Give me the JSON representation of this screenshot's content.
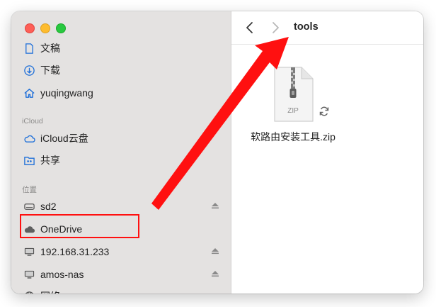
{
  "window": {
    "folder_title": "tools"
  },
  "sidebar": {
    "sections": [
      {
        "header": ""
      },
      {
        "header": "iCloud"
      },
      {
        "header": "位置"
      }
    ],
    "items": [
      {
        "label": "文稿",
        "icon": "document-icon"
      },
      {
        "label": "下载",
        "icon": "download-icon"
      },
      {
        "label": "yuqingwang",
        "icon": "home-icon"
      },
      {
        "label": "iCloud云盘",
        "icon": "icloud-icon"
      },
      {
        "label": "共享",
        "icon": "shared-folder-icon"
      },
      {
        "label": "sd2",
        "icon": "drive-icon",
        "ejectable": true
      },
      {
        "label": "OneDrive",
        "icon": "cloud-filled-icon",
        "highlighted": true
      },
      {
        "label": "192.168.31.233",
        "icon": "monitor-icon",
        "ejectable": true
      },
      {
        "label": "amos-nas",
        "icon": "monitor-icon",
        "ejectable": true
      },
      {
        "label": "网络",
        "icon": "network-icon"
      }
    ]
  },
  "content": {
    "files": [
      {
        "name": "软路由安装工具.zip",
        "icon_badge": "ZIP",
        "status_icon": "sync-icon"
      }
    ]
  },
  "annotation": {
    "color": "#ff1010"
  },
  "colors": {
    "sidebar_bg": "#e4e2e1",
    "accent": "#1e6fd9",
    "close": "#fe5f57",
    "minimize": "#febc2e",
    "maximize": "#28c840"
  }
}
